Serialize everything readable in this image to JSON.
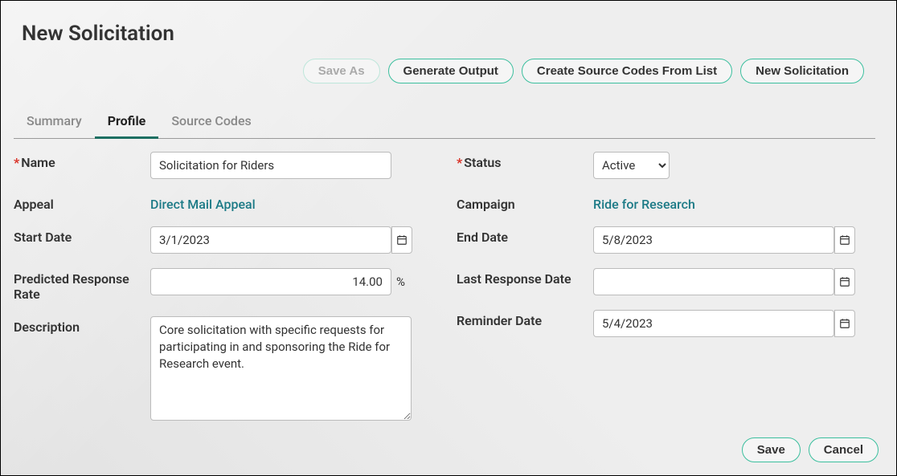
{
  "title": "New Solicitation",
  "toolbar": {
    "save_as": "Save As",
    "generate_output": "Generate Output",
    "create_source_codes": "Create Source Codes From List",
    "new_solicitation": "New Solicitation"
  },
  "tabs": {
    "summary": "Summary",
    "profile": "Profile",
    "source_codes": "Source Codes",
    "active": "profile"
  },
  "labels": {
    "name": "Name",
    "appeal": "Appeal",
    "start_date": "Start Date",
    "predicted_response_rate": "Predicted Response Rate",
    "description": "Description",
    "status": "Status",
    "campaign": "Campaign",
    "end_date": "End Date",
    "last_response_date": "Last Response Date",
    "reminder_date": "Reminder Date",
    "percent": "%"
  },
  "fields": {
    "name": "Solicitation for Riders",
    "appeal_link": "Direct Mail Appeal",
    "start_date": "3/1/2023",
    "predicted_response_rate": "14.00",
    "description": "Core solicitation with specific requests for participating in and sponsoring the Ride for Research event.",
    "status": "Active",
    "campaign_link": "Ride for Research",
    "end_date": "5/8/2023",
    "last_response_date": "",
    "reminder_date": "5/4/2023"
  },
  "footer": {
    "save": "Save",
    "cancel": "Cancel"
  }
}
